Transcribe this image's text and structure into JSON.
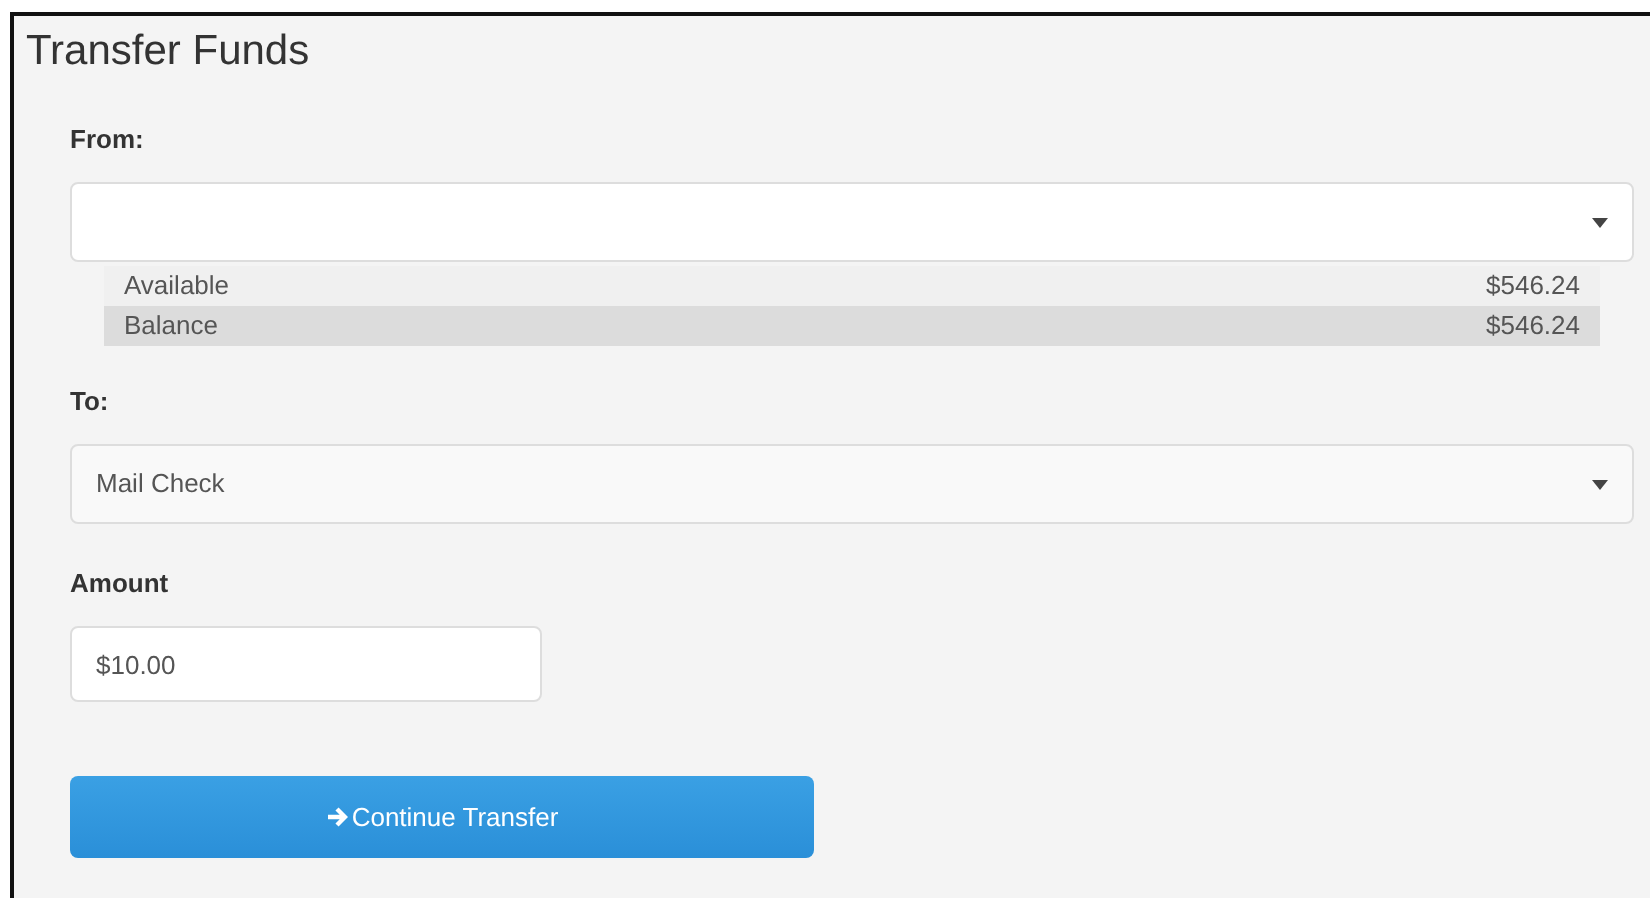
{
  "title": "Transfer Funds",
  "from": {
    "label": "From:"
  },
  "balances": [
    {
      "label": "Available",
      "amount": "$546.24",
      "selected": false
    },
    {
      "label": "Balance",
      "amount": "$546.24",
      "selected": true
    }
  ],
  "to": {
    "label": "To:",
    "value": "Mail Check"
  },
  "amount": {
    "label": "Amount",
    "value": "$10.00"
  },
  "button": {
    "label": "Continue Transfer"
  }
}
